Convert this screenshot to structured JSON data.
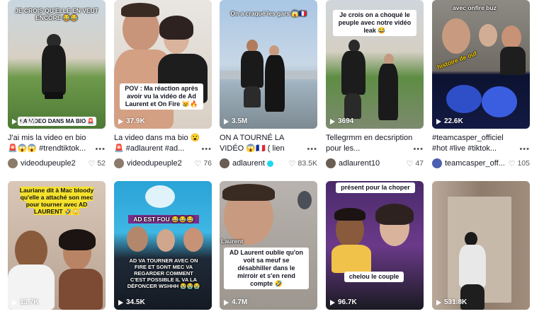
{
  "videos": [
    {
      "overlay": "JE CROIS QU'ELLE EN VEUT ENCORE 😂😂",
      "views": "3.7M",
      "strip": "LA VIDEO DANS MA BIO 🚨",
      "title": "J'ai mis la video en bio 🚨😱😱 #trendtiktok...",
      "user": "videodupeuple2",
      "likes": "52"
    },
    {
      "overlay": "POV : Ma réaction après avoir vu la vidéo de Ad Laurent et On Fire 😿🔥",
      "views": "37.9K",
      "title": "La video dans ma bio 😮 🚨 #adlaurent #ad...",
      "user": "videodupeuple2",
      "likes": "76"
    },
    {
      "overlay": "On a craqué les gars 😱🇫🇷",
      "views": "3.5M",
      "title": "ON A TOURNÉ LA VIDÉO 😱🇫🇷 ( lien dans...",
      "user": "adlaurent",
      "likes": "83.5K"
    },
    {
      "overlay": "Je crois on a choqué le peuple avec notre vidéo leak 😂",
      "views": "3694",
      "title": "Tellegrmm en decsription pour les...",
      "user": "adlaurent10",
      "likes": "47"
    },
    {
      "overlay": "avec onfire buz",
      "sticker": "histoire de ouf",
      "views": "22.6K",
      "title": "#teamcasper_officiel #hot #live #tiktok...",
      "user": "teamcasper_off...",
      "likes": "105"
    },
    {
      "overlay": "Lauriane dit à Mac bloody qu'elle a attaché son mec pour tourner avec AD LAURENT 🤣😳",
      "views": "13.7K"
    },
    {
      "overlay_top": "AD EST FOU 😂😂😂",
      "overlay": "AD VA TOURNER AVEC ON FIRE ET SONT MEC VA REGARDER COMMENT C'EST POSSIBLE IL VA LA DÉFONCER WSHHH 😭😭😭",
      "views": "34.5K"
    },
    {
      "overlay": "AD Laurent oublie qu'on voit sa meuf se désabhiller dans le mirroir et s'en rend compte 🤣",
      "label": "Laurent",
      "views": "4.7M"
    },
    {
      "overlay": "présent pour la choper",
      "overlay2": "chelou le couple",
      "views": "96.7K"
    },
    {
      "views": "531.8K"
    }
  ],
  "colors": {
    "verified": "#20d5ec",
    "text": "#161823",
    "muted": "#555555"
  }
}
